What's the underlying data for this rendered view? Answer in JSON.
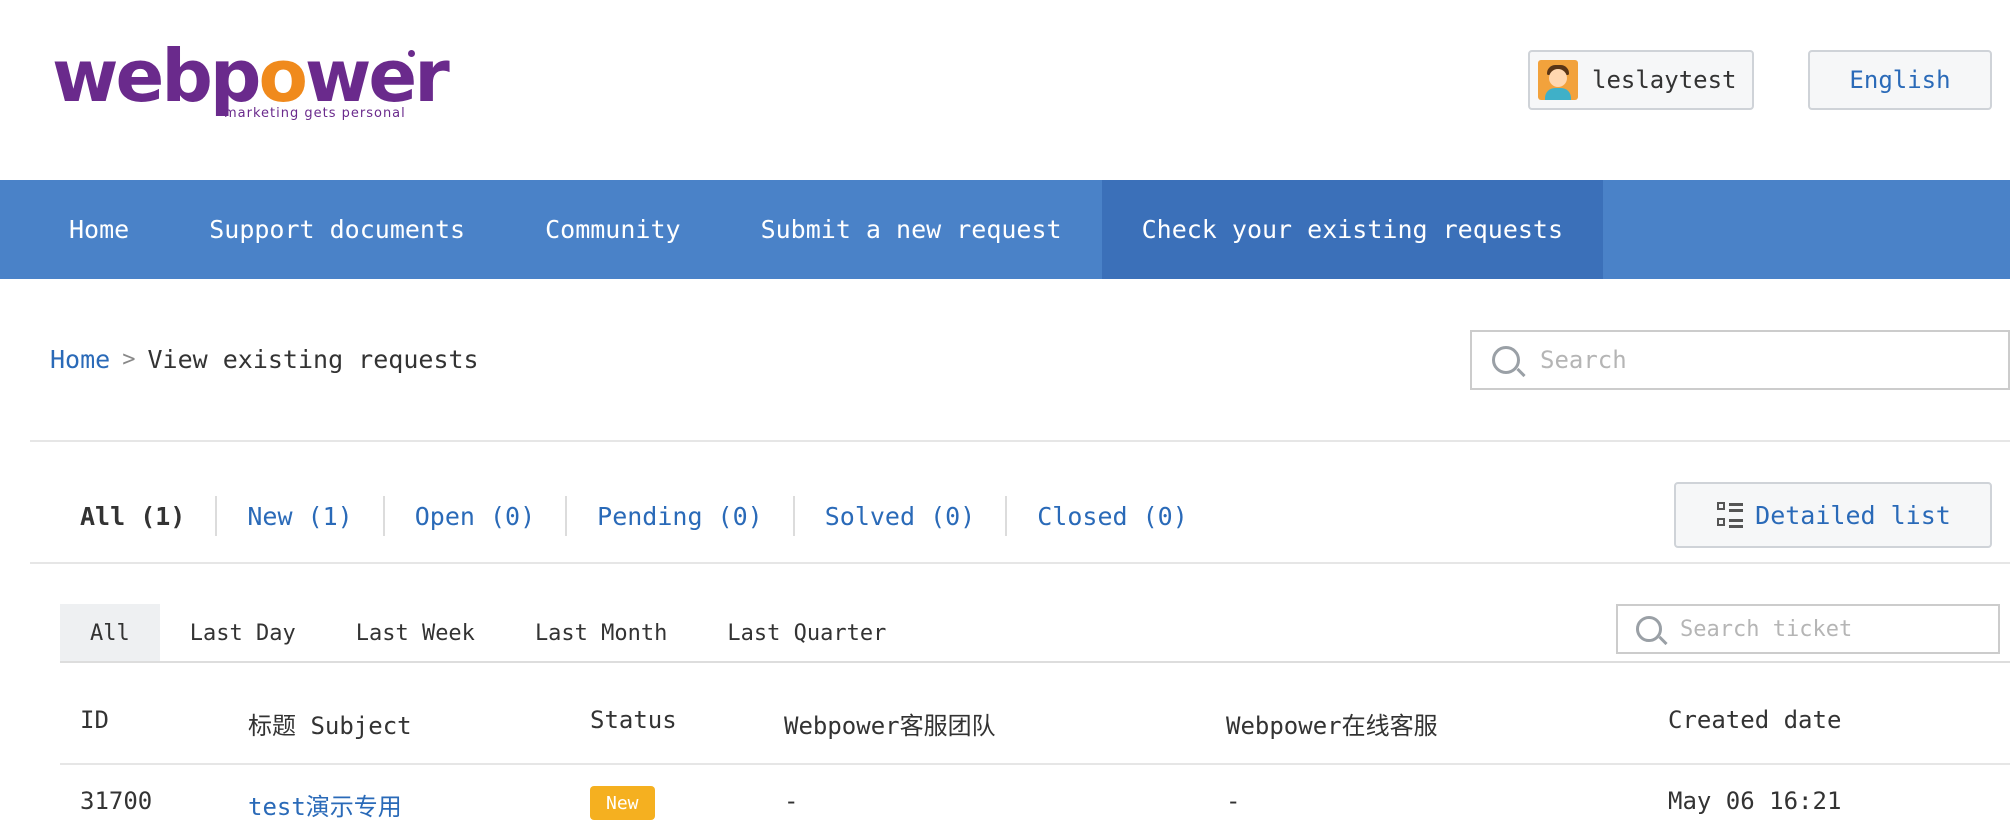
{
  "brand": {
    "logo_text_a": "webp",
    "logo_text_o": "o",
    "logo_text_b": "wer",
    "tagline": "marketing gets personal"
  },
  "header": {
    "username": "leslaytest",
    "language": "English"
  },
  "nav": {
    "items": [
      {
        "label": "Home"
      },
      {
        "label": "Support documents"
      },
      {
        "label": "Community"
      },
      {
        "label": "Submit a new request"
      },
      {
        "label": "Check your existing requests"
      }
    ]
  },
  "breadcrumb": {
    "home": "Home",
    "separator": ">",
    "current": "View existing requests"
  },
  "search": {
    "placeholder": "Search"
  },
  "status_filters": [
    {
      "label": "All (1)"
    },
    {
      "label": "New (1)"
    },
    {
      "label": "Open (0)"
    },
    {
      "label": "Pending (0)"
    },
    {
      "label": "Solved (0)"
    },
    {
      "label": "Closed (0)"
    }
  ],
  "view_toggle": {
    "label": "Detailed list"
  },
  "period_tabs": [
    {
      "label": "All"
    },
    {
      "label": "Last Day"
    },
    {
      "label": "Last Week"
    },
    {
      "label": "Last Month"
    },
    {
      "label": "Last Quarter"
    }
  ],
  "ticket_search": {
    "placeholder": "Search ticket"
  },
  "table": {
    "headers": [
      "ID",
      "标题 Subject",
      "Status",
      "Webpower客服团队",
      "Webpower在线客服",
      "Created date"
    ],
    "rows": [
      {
        "id": "31700",
        "subject": "test演示专用",
        "status": "New",
        "team": "-",
        "online": "-",
        "created": "May 06 16:21"
      }
    ]
  },
  "colors": {
    "nav_bg": "#4a82c8",
    "nav_active": "#3b70b9",
    "link": "#2a6ab8",
    "badge_new": "#f5b020",
    "logo": "#6a2a8c",
    "logo_accent": "#f08a1c"
  }
}
